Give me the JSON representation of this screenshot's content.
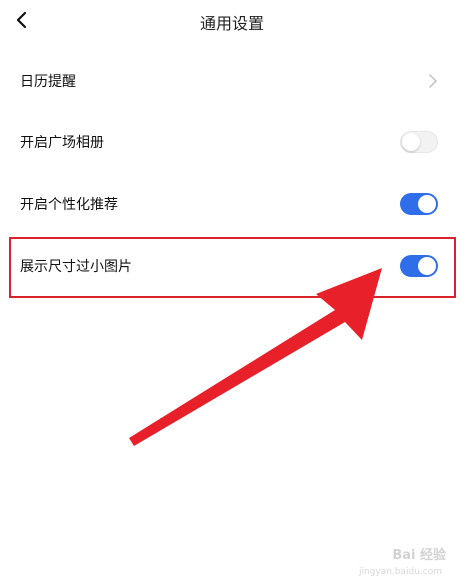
{
  "header": {
    "title": "通用设置",
    "back_icon": "chevron-left-icon"
  },
  "settings": [
    {
      "label": "日历提醒",
      "control": "chevron",
      "icon": "chevron-right-icon"
    },
    {
      "label": "开启广场相册",
      "control": "toggle",
      "enabled": false
    },
    {
      "label": "开启个性化推荐",
      "control": "toggle",
      "enabled": true
    },
    {
      "label": "展示尺寸过小图片",
      "control": "toggle",
      "enabled": true
    }
  ],
  "annotation": {
    "highlight_color": "#d9222a",
    "arrow_color": "#e8202a"
  },
  "colors": {
    "toggle_on": "#2f6ee8",
    "toggle_off": "#f2f2f2",
    "chevron": "#c8c8c8"
  },
  "watermark": {
    "text": "Bai 经验",
    "subtext": "jingyan.baidu.com"
  }
}
